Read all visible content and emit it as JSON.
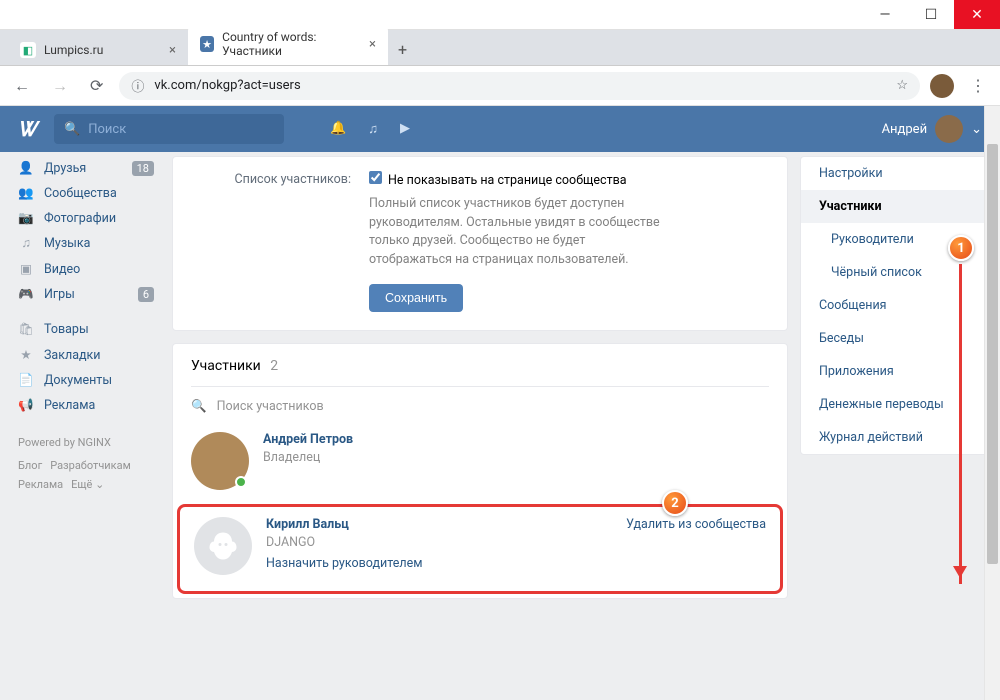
{
  "window": {
    "tabs": [
      {
        "title": "Lumpics.ru",
        "active": false
      },
      {
        "title": "Country of words: Участники",
        "active": true
      }
    ],
    "url": "vk.com/nokgp?act=users"
  },
  "vk": {
    "search_placeholder": "Поиск",
    "user_name": "Андрей"
  },
  "leftnav": {
    "items": [
      {
        "label": "Друзья",
        "badge": "18"
      },
      {
        "label": "Сообщества",
        "badge": null
      },
      {
        "label": "Фотографии",
        "badge": null
      },
      {
        "label": "Музыка",
        "badge": null
      },
      {
        "label": "Видео",
        "badge": null
      },
      {
        "label": "Игры",
        "badge": "6"
      },
      {
        "label": "Товары",
        "badge": null
      },
      {
        "label": "Закладки",
        "badge": null
      },
      {
        "label": "Документы",
        "badge": null
      },
      {
        "label": "Реклама",
        "badge": null
      }
    ],
    "powered": "Powered by NGINX",
    "footer": [
      "Блог",
      "Разработчикам",
      "Реклама",
      "Ещё ⌄"
    ]
  },
  "settings_form": {
    "label": "Список участников:",
    "checkbox_label": "Не показывать на странице сообщества",
    "description": "Полный список участников будет доступен руководителям. Остальные увидят в сообществе только друзей. Сообщество не будет отображаться на страницах пользователей.",
    "save_btn": "Сохранить"
  },
  "members_section": {
    "title": "Участники",
    "count": "2",
    "search_placeholder": "Поиск участников",
    "members": [
      {
        "name": "Андрей Петров",
        "role": "Владелец",
        "action": null,
        "remove": null,
        "online": true
      },
      {
        "name": "Кирилл Вальц",
        "role": "DJANGO",
        "action": "Назначить руководителем",
        "remove": "Удалить из сообщества",
        "online": false
      }
    ]
  },
  "rightnav": {
    "items": [
      {
        "label": "Настройки",
        "sub": false,
        "active": false
      },
      {
        "label": "Участники",
        "sub": false,
        "active": true
      },
      {
        "label": "Руководители",
        "sub": true,
        "active": false
      },
      {
        "label": "Чёрный список",
        "sub": true,
        "active": false
      },
      {
        "label": "Сообщения",
        "sub": false,
        "active": false
      },
      {
        "label": "Беседы",
        "sub": false,
        "active": false
      },
      {
        "label": "Приложения",
        "sub": false,
        "active": false
      },
      {
        "label": "Денежные переводы",
        "sub": false,
        "active": false
      },
      {
        "label": "Журнал действий",
        "sub": false,
        "active": false
      }
    ]
  },
  "callouts": {
    "one": "1",
    "two": "2"
  }
}
